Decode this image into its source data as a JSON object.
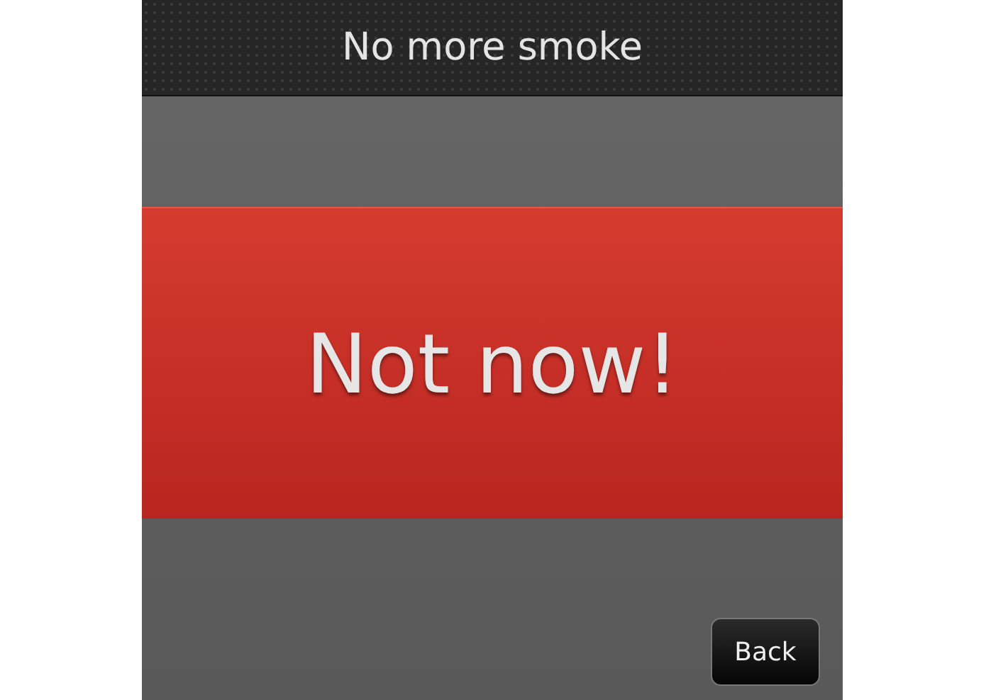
{
  "title_bar": {
    "title": "No more smoke"
  },
  "message": {
    "text": "Not now!"
  },
  "buttons": [
    {
      "label": "Back"
    }
  ]
}
